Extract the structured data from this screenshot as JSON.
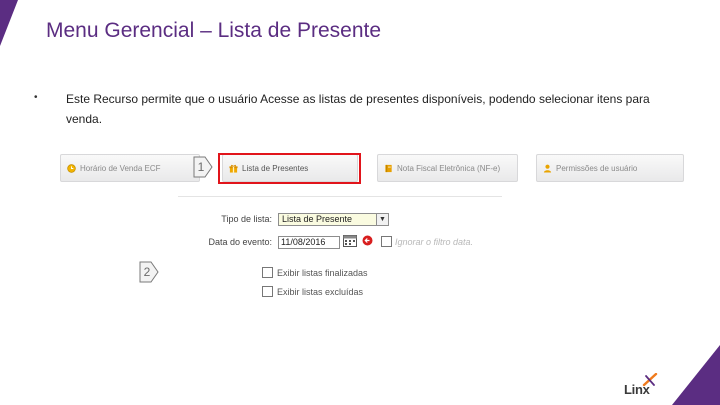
{
  "slide": {
    "title": "Menu Gerencial – Lista de Presente",
    "bullet_char": "•",
    "description": "Este Recurso permite que o usuário Acesse as listas de presentes disponíveis, podendo selecionar itens para venda."
  },
  "toolbar": {
    "items": [
      {
        "label": "Horário de Venda ECF",
        "icon": "clock-icon"
      },
      {
        "label": "Lista de Presentes",
        "icon": "gift-icon"
      },
      {
        "label": "Nota Fiscal Eletrônica (NF-e)",
        "icon": "book-icon"
      },
      {
        "label": "Permissões de usuário",
        "icon": "user-icon"
      }
    ]
  },
  "markers": {
    "step1": "1",
    "step2": "2"
  },
  "form": {
    "list_type_label": "Tipo de lista:",
    "list_type_value": "Lista de Presente",
    "event_date_label": "Data do evento:",
    "event_date_value": "11/08/2016",
    "ignore_filter_label": "Ignorar o filtro data.",
    "show_finished_label": "Exibir listas finalizadas",
    "show_deleted_label": "Exibir listas excluídas"
  },
  "logo": {
    "text": "Linx"
  },
  "colors": {
    "title": "#5b2d82",
    "highlight": "#e1141b",
    "logo_accent": "#f07b1d"
  }
}
